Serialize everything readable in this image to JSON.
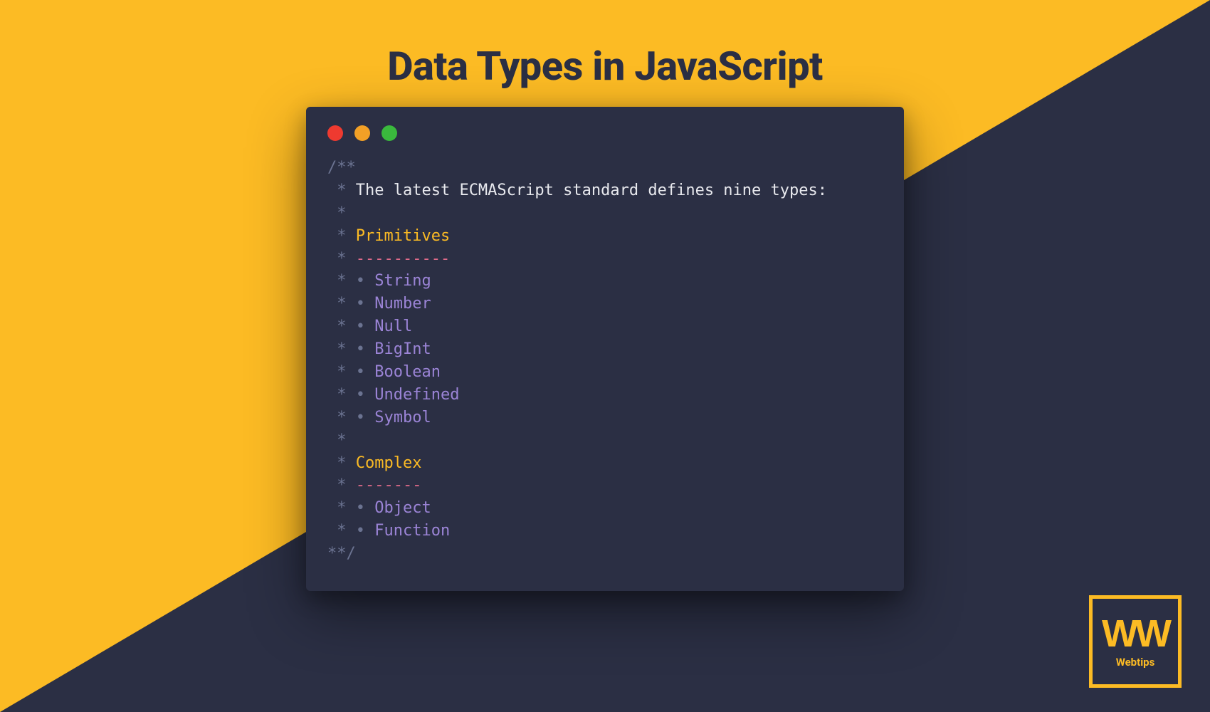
{
  "title": "Data Types in JavaScript",
  "code": {
    "open": "/**",
    "intro": "The latest ECMAScript standard defines nine types:",
    "section1": {
      "header": "Primitives",
      "underline": "----------",
      "items": [
        "String",
        "Number",
        "Null",
        "BigInt",
        "Boolean",
        "Undefined",
        "Symbol"
      ]
    },
    "section2": {
      "header": "Complex",
      "underline": "-------",
      "items": [
        "Object",
        "Function"
      ]
    },
    "close": "**/"
  },
  "logo": {
    "mark": "WW",
    "text": "Webtips"
  }
}
